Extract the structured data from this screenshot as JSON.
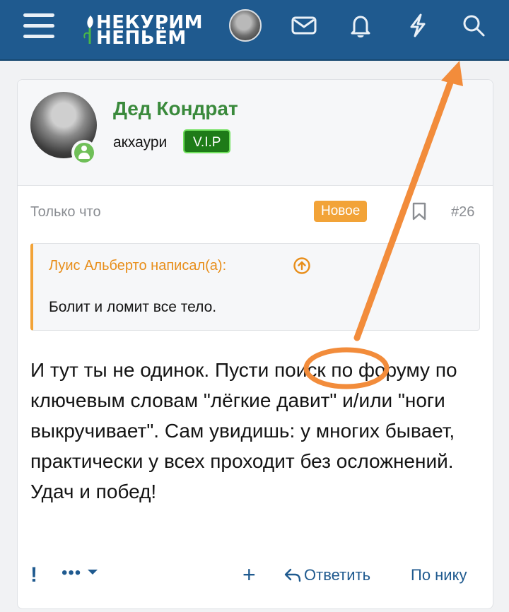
{
  "topbar": {
    "logo_line1": "НЕКУРИМ",
    "logo_line2": "НЕПЬЁМ",
    "colors": {
      "background": "#1f5a8f",
      "accent_green": "#3a8a3c"
    },
    "icons": [
      "menu-icon",
      "mail-icon",
      "bell-icon",
      "lightning-icon",
      "search-icon"
    ]
  },
  "post": {
    "author": "Дед Кондрат",
    "user_title": "акхаури",
    "badge": "V.I.P",
    "time": "Только что",
    "new_label": "Новое",
    "number": "#26",
    "quote": {
      "author_line": "Луис Альберто написал(а):",
      "text": "Болит и ломит все тело."
    },
    "body": [
      "И тут ты не одинок. Пусти поиск по форуму по ключевым словам \"лёгкие давит\" и/или \"ноги выкручивает\". Сам увидишь: у многих бывает, практически у всех проходит без осложнений.",
      "Удач и побед!"
    ],
    "actions": {
      "report": "!",
      "more": "•••",
      "plus": "+",
      "reply": "Ответить",
      "by_nick": "По нику"
    }
  },
  "annotation": {
    "color": "#f28c3b"
  }
}
